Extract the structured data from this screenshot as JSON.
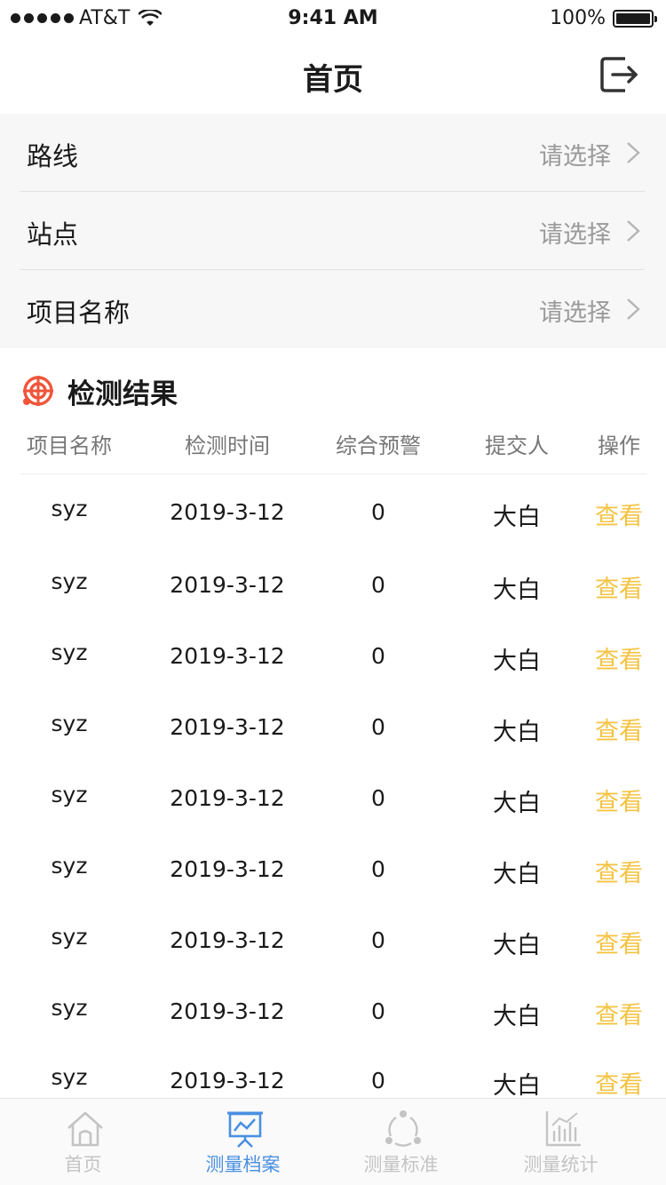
{
  "status_bar": {
    "carrier": "AT&T",
    "time": "9:41 AM",
    "battery": "100%"
  },
  "nav": {
    "title": "首页"
  },
  "filters": [
    {
      "label": "路线",
      "value": "请选择"
    },
    {
      "label": "站点",
      "value": "请选择"
    },
    {
      "label": "项目名称",
      "value": "请选择"
    }
  ],
  "results": {
    "title": "检测结果",
    "columns": [
      "项目名称",
      "检测时间",
      "综合预警",
      "提交人",
      "操作"
    ],
    "rows": [
      {
        "name": "syz",
        "time": "2019-3-12",
        "warning": "0",
        "submitter": "大白",
        "action": "查看"
      },
      {
        "name": "syz",
        "time": "2019-3-12",
        "warning": "0",
        "submitter": "大白",
        "action": "查看"
      },
      {
        "name": "syz",
        "time": "2019-3-12",
        "warning": "0",
        "submitter": "大白",
        "action": "查看"
      },
      {
        "name": "syz",
        "time": "2019-3-12",
        "warning": "0",
        "submitter": "大白",
        "action": "查看"
      },
      {
        "name": "syz",
        "time": "2019-3-12",
        "warning": "0",
        "submitter": "大白",
        "action": "查看"
      },
      {
        "name": "syz",
        "time": "2019-3-12",
        "warning": "0",
        "submitter": "大白",
        "action": "查看"
      },
      {
        "name": "syz",
        "time": "2019-3-12",
        "warning": "0",
        "submitter": "大白",
        "action": "查看"
      },
      {
        "name": "syz",
        "time": "2019-3-12",
        "warning": "0",
        "submitter": "大白",
        "action": "查看"
      },
      {
        "name": "syz",
        "time": "2019-3-12",
        "warning": "0",
        "submitter": "大白",
        "action": "查看"
      }
    ]
  },
  "tabs": [
    {
      "label": "首页",
      "icon": "home-icon",
      "active": false
    },
    {
      "label": "测量档案",
      "icon": "presentation-chart-icon",
      "active": true
    },
    {
      "label": "测量标准",
      "icon": "circle-nodes-icon",
      "active": false
    },
    {
      "label": "测量统计",
      "icon": "bar-chart-icon",
      "active": false
    }
  ],
  "colors": {
    "accent": "#f5c342",
    "tab_active": "#4a90e2",
    "tab_inactive": "#c4c4c4",
    "section_icon": "#f0553a"
  }
}
